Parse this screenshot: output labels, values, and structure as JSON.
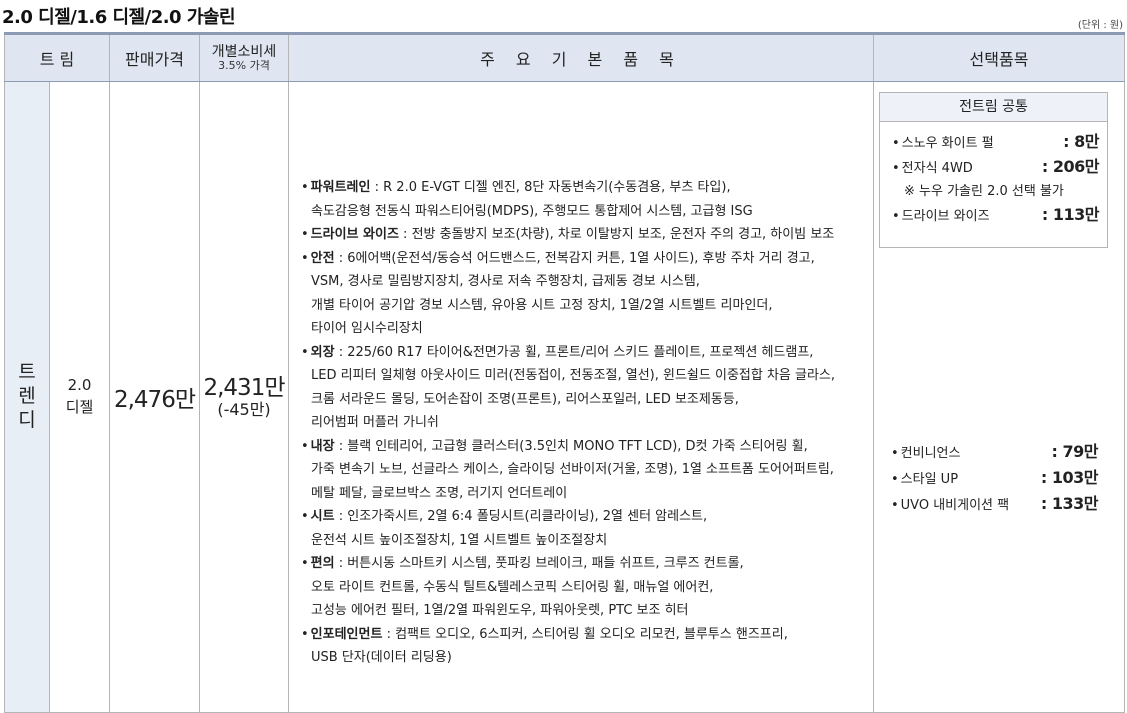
{
  "title": "2.0 디젤/1.6 디젤/2.0 가솔린",
  "unit": "(단위 : 원)",
  "header": {
    "trim": "트 림",
    "price": "판매가격",
    "tax_main": "개별소비세",
    "tax_sub": "3.5% 가격",
    "items": "주 요 기 본 품 목",
    "options": "선택품목"
  },
  "row": {
    "trim": [
      "트",
      "렌",
      "디"
    ],
    "engine": [
      "2.0",
      "디젤"
    ],
    "price": "2,476만",
    "tax_price": "2,431만",
    "tax_diff": "(-45만)"
  },
  "items": [
    {
      "label": "파워트레인",
      "lines": [
        "R 2.0 E-VGT 디젤 엔진, 8단 자동변속기(수동겸용, 부츠 타입),",
        "속도감응형 전동식 파워스티어링(MDPS), 주행모드 통합제어 시스템, 고급형 ISG"
      ]
    },
    {
      "label": "드라이브 와이즈",
      "lines": [
        "전방 충돌방지 보조(차량), 차로 이탈방지 보조, 운전자 주의 경고, 하이빔 보조"
      ]
    },
    {
      "label": "안전",
      "lines": [
        "6에어백(운전석/동승석 어드밴스드, 전복감지 커튼, 1열 사이드), 후방 주차 거리 경고,",
        "VSM, 경사로 밀림방지장치, 경사로 저속 주행장치, 급제동 경보 시스템,",
        "개별 타이어 공기압 경보 시스템, 유아용 시트 고정 장치, 1열/2열 시트벨트 리마인더,",
        "타이어 임시수리장치"
      ]
    },
    {
      "label": "외장",
      "lines": [
        "225/60 R17 타이어&전면가공 휠, 프론트/리어 스키드 플레이트, 프로젝션 헤드램프,",
        "LED 리피터 일체형 아웃사이드 미러(전동접이, 전동조절, 열선), 윈드쉴드 이중접합 차음 글라스,",
        "크롬 서라운드 몰딩, 도어손잡이 조명(프론트), 리어스포일러, LED 보조제동등,",
        "리어범퍼 머플러 가니쉬"
      ]
    },
    {
      "label": "내장",
      "lines": [
        "블랙 인테리어, 고급형 클러스터(3.5인치 MONO TFT LCD), D컷 가죽 스티어링 휠,",
        "가죽 변속기 노브, 선글라스 케이스, 슬라이딩 선바이저(거울, 조명), 1열 소프트폼 도어어퍼트림,",
        "메탈 페달, 글로브박스 조명, 러기지 언더트레이"
      ]
    },
    {
      "label": "시트",
      "lines": [
        "인조가죽시트, 2열 6:4 폴딩시트(리클라이닝), 2열 센터 암레스트,",
        "운전석 시트 높이조절장치, 1열 시트벨트 높이조절장치"
      ]
    },
    {
      "label": "편의",
      "lines": [
        "버튼시동 스마트키 시스템, 풋파킹 브레이크, 패들 쉬프트, 크루즈 컨트롤,",
        "오토 라이트 컨트롤, 수동식 틸트&텔레스코픽 스티어링 휠, 매뉴얼 에어컨,",
        "고성능 에어컨 필터, 1열/2열 파워윈도우, 파워아웃렛, PTC 보조 히터"
      ]
    },
    {
      "label": "인포테인먼트",
      "lines": [
        "컴팩트 오디오, 6스피커, 스티어링 휠 오디오 리모컨, 블루투스 핸즈프리,",
        "USB 단자(데이터 리딩용)"
      ]
    }
  ],
  "common": {
    "title": "전트림 공통",
    "options": [
      {
        "name": "스노우 화이트 펄",
        "price": ": 8만"
      },
      {
        "name": "전자식 4WD",
        "price": ": 206만",
        "note": "※ 누우 가솔린 2.0 선택 불가"
      },
      {
        "name": "드라이브 와이즈",
        "price": ": 113만"
      }
    ]
  },
  "extra_options": [
    {
      "name": "컨비니언스",
      "price": ": 79만"
    },
    {
      "name": "스타일 UP",
      "price": ": 103만"
    },
    {
      "name": "UVO 내비게이션 팩",
      "price": ": 133만"
    }
  ]
}
